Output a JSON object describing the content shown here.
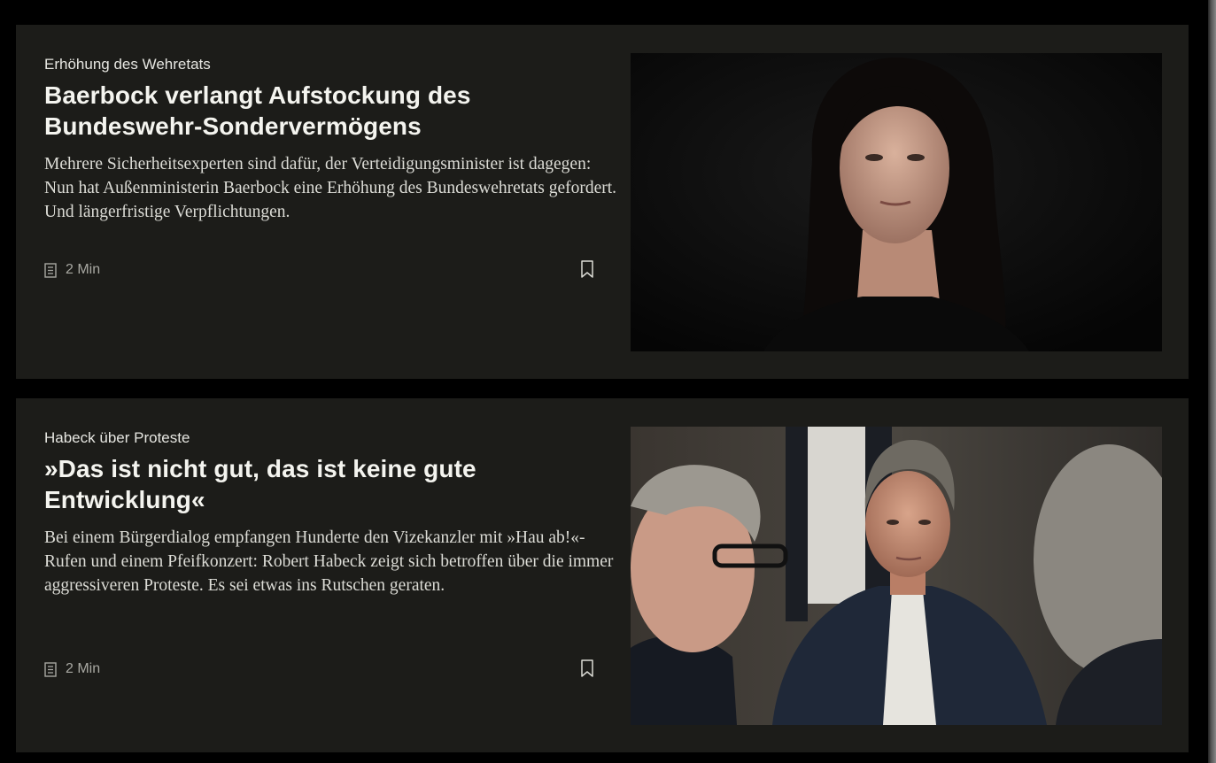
{
  "articles": [
    {
      "kicker": "Erhöhung des Wehretats",
      "headline": "Baerbock verlangt Aufstockung des Bundeswehr-Sondervermögens",
      "teaser": "Mehrere Sicherheitsexperten sind dafür, der Verteidigungsminister ist dagegen: Nun hat Außenministerin Baerbock eine Erhöhung des Bundeswehretats gefordert. Und längerfristige Verpflichtungen.",
      "reading_time": "2 Min",
      "reading_icon": "article-icon",
      "bookmark_icon": "bookmark-icon"
    },
    {
      "kicker": "Habeck über Proteste",
      "headline": "»Das ist nicht gut, das ist keine gute Entwicklung«",
      "teaser": "Bei einem Bürgerdialog empfangen Hunderte den Vizekanzler mit »Hau ab!«-Rufen und einem Pfeifkonzert: Robert Habeck zeigt sich betroffen über die immer aggressiveren Proteste. Es sei etwas ins Rutschen geraten.",
      "reading_time": "2 Min",
      "reading_icon": "article-icon",
      "bookmark_icon": "bookmark-icon"
    }
  ],
  "colors": {
    "page_background": "#000000",
    "card_background": "#1c1c19",
    "headline": "#f4f4ef",
    "meta": "#a8a8a2"
  }
}
